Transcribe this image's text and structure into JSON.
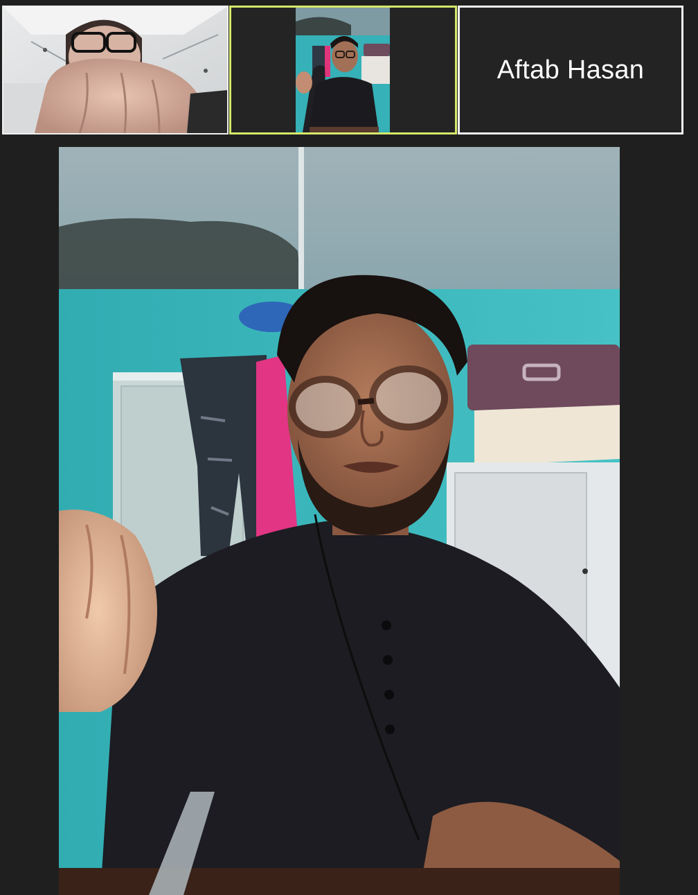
{
  "window": {
    "background": "#1f1f1f"
  },
  "participants": [
    {
      "id": "p1",
      "kind": "video",
      "active_speaker": false
    },
    {
      "id": "p2",
      "kind": "video",
      "active_speaker": true,
      "highlight_color": "#d6e86a"
    },
    {
      "id": "p3",
      "kind": "name-only",
      "display_name": "Aftab Hasan",
      "active_speaker": false
    }
  ],
  "main_view": {
    "kind": "video",
    "spotlight": "p2"
  }
}
